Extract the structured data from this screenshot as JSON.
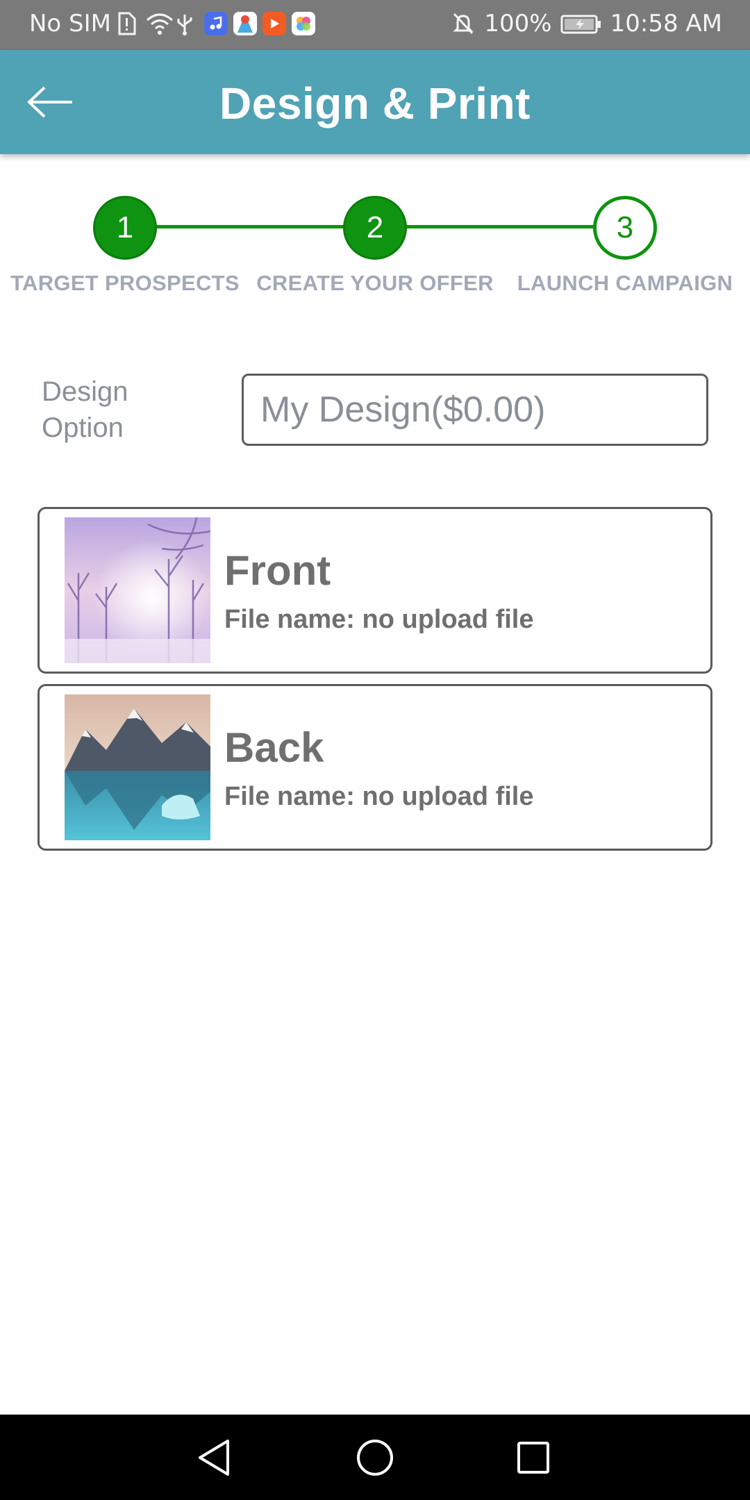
{
  "status_bar": {
    "carrier": "No SIM",
    "battery": "100%",
    "time": "10:58 AM",
    "icons": [
      "sim-alert-icon",
      "wifi-icon",
      "usb-icon",
      "music-app-icon",
      "du-app-icon",
      "video-app-icon",
      "photos-app-icon",
      "bell-off-icon",
      "battery-icon"
    ]
  },
  "app_bar": {
    "title": "Design & Print",
    "back_icon": "arrow-left-icon",
    "color": "#50a2b5"
  },
  "stepper": {
    "active_color": "#0e9410",
    "steps": [
      {
        "number": "1",
        "label": "TARGET PROSPECTS",
        "state": "completed"
      },
      {
        "number": "2",
        "label": "CREATE YOUR OFFER",
        "state": "completed"
      },
      {
        "number": "3",
        "label": "LAUNCH CAMPAIGN",
        "state": "current"
      }
    ]
  },
  "design_option": {
    "label_line1": "Design",
    "label_line2": "Option",
    "value": "My Design($0.00)"
  },
  "cards": [
    {
      "title": "Front",
      "file_text": "File name: no upload file",
      "thumbnail": "winter-forest-image"
    },
    {
      "title": "Back",
      "file_text": "File name: no upload file",
      "thumbnail": "mountain-lake-image"
    }
  ],
  "nav_bar": {
    "icons": [
      "back-triangle-icon",
      "home-circle-icon",
      "recents-square-icon"
    ]
  }
}
